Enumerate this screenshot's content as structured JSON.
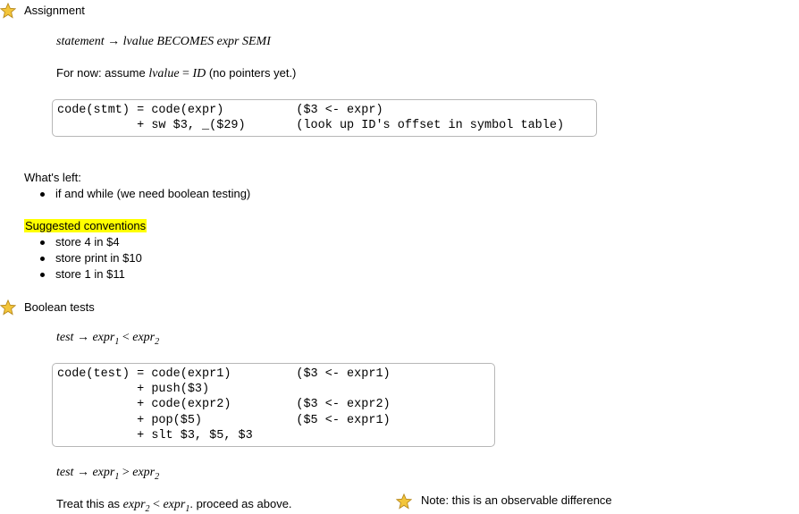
{
  "icons": {
    "star": "star-icon",
    "star_color": "#f3c53a",
    "star_outline": "#b88a1e"
  },
  "assignment": {
    "heading": "Assignment",
    "rule": {
      "lhs": "statement",
      "arrow": "→",
      "rhs": "lvalue BECOMES expr SEMI"
    },
    "note_prefix": "For now: assume ",
    "note_math": {
      "lhs": "lvalue",
      "eq": "=",
      "rhs": "ID"
    },
    "note_suffix": " (no pointers yet.)",
    "code_lines": [
      "code(stmt) = code(expr)          ($3 <- expr)",
      "           + sw $3, _($29)       (look up ID's offset in symbol table)"
    ]
  },
  "whats_left": {
    "heading": "What's left:",
    "items": [
      "if and while (we need boolean testing)"
    ]
  },
  "conventions": {
    "heading": "Suggested conventions",
    "highlight_color": "#ffff00",
    "items": [
      "store 4 in $4",
      "store print in $10",
      "store 1 in $11"
    ]
  },
  "boolean_tests": {
    "heading": "Boolean tests",
    "rule_lt": {
      "lhs": "test",
      "arrow": "→",
      "a": "expr",
      "a_sub": "1",
      "op": "<",
      "b": "expr",
      "b_sub": "2"
    },
    "code_lines": [
      "code(test) = code(expr1)         ($3 <- expr1)",
      "           + push($3)",
      "           + code(expr2)         ($3 <- expr2)",
      "           + pop($5)             ($5 <- expr1)",
      "           + slt $3, $5, $3"
    ],
    "rule_gt": {
      "lhs": "test",
      "arrow": "→",
      "a": "expr",
      "a_sub": "1",
      "op": ">",
      "b": "expr",
      "b_sub": "2"
    },
    "treat_prefix": "Treat this as ",
    "treat_math": {
      "a": "expr",
      "a_sub": "2",
      "op": "<",
      "b": "expr",
      "b_sub": "1"
    },
    "treat_suffix": ". proceed as above.",
    "note": "Note: this is an observable difference"
  }
}
